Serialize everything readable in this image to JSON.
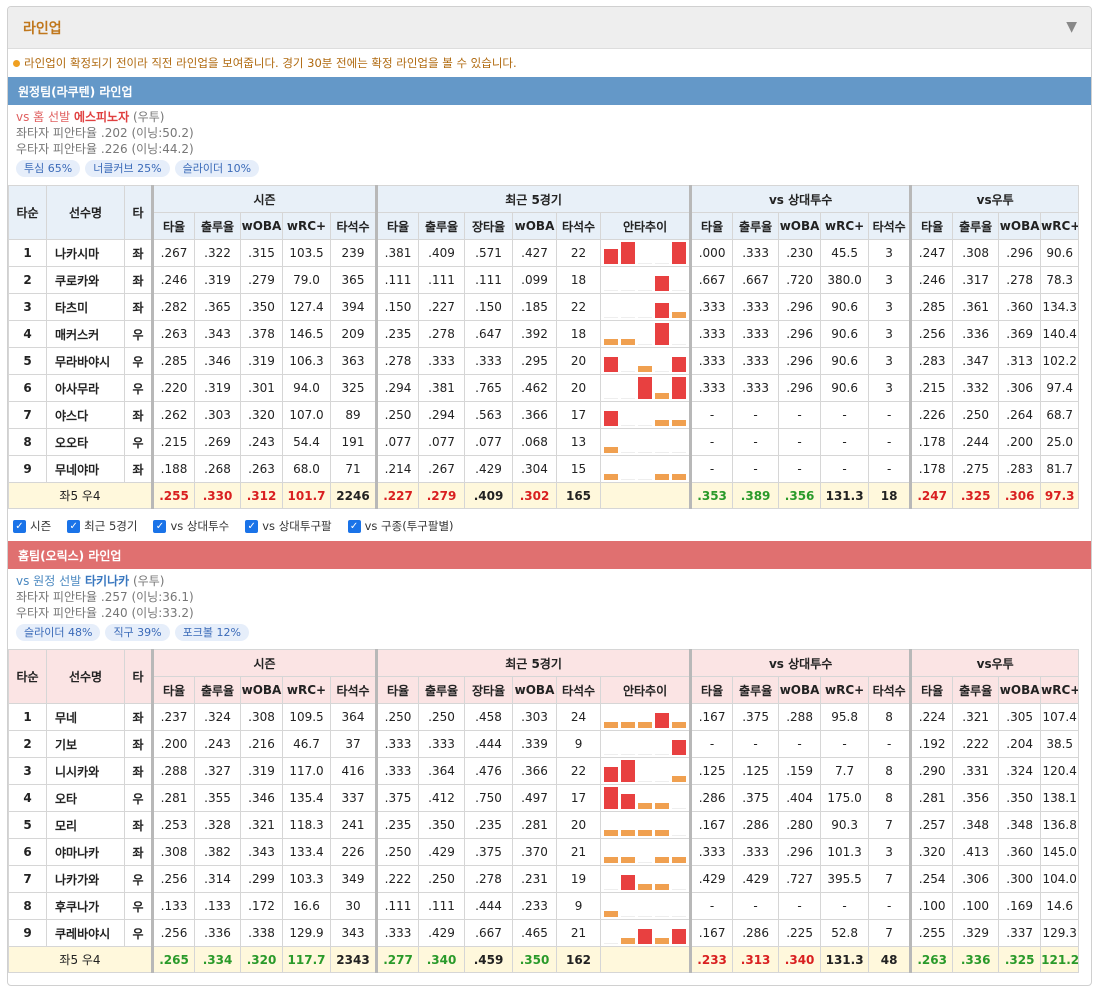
{
  "header": {
    "title": "라인업",
    "toggle_icon": "triangle-down-icon"
  },
  "notice": "라인업이 확정되기 전이라 직전 라인업을 보여줍니다. 경기 30분 전에는 확정 라인업을 볼 수 있습니다.",
  "columns": {
    "order": "타순",
    "name": "선수명",
    "hand": "타",
    "groups": [
      "시즌",
      "최근 5경기",
      "vs 상대투수",
      "vs우투"
    ],
    "season": [
      "타율",
      "출루율",
      "wOBA",
      "wRC+",
      "타석수"
    ],
    "recent": [
      "타율",
      "출루율",
      "장타율",
      "wOBA",
      "타석수",
      "안타추이"
    ],
    "vs_pitcher": [
      "타율",
      "출루율",
      "wOBA",
      "wRC+",
      "타석수"
    ],
    "vs_hand": [
      "타율",
      "출루율",
      "wOBA",
      "wRC+"
    ]
  },
  "checkboxes": [
    "시즌",
    "최근 5경기",
    "vs 상대투수",
    "vs 상대투구팔",
    "vs 구종(투구팔별)"
  ],
  "away": {
    "team_label": "원정팀(라쿠텐) 라인업",
    "vs_prefix": "vs 홈 선발",
    "pitcher": "에스피노자",
    "pitcher_hand": "(우투)",
    "vs_left": "좌타자 피안타율 .202 (이닝:50.2)",
    "vs_right": "우타자 피안타율 .226 (이닝:44.2)",
    "pitches": [
      "투심 65%",
      "너클커브 25%",
      "슬라이더 10%"
    ],
    "rows": [
      {
        "o": "1",
        "n": "나카시마",
        "h": "좌",
        "s": [
          ".267",
          ".322",
          ".315",
          "103.5",
          "239"
        ],
        "r": [
          ".381",
          ".409",
          ".571",
          ".427",
          "22"
        ],
        "c": [
          1,
          2,
          0,
          0,
          2
        ],
        "p": [
          ".000",
          ".333",
          ".230",
          "45.5",
          "3"
        ],
        "v": [
          ".247",
          ".308",
          ".296",
          "90.6"
        ]
      },
      {
        "o": "2",
        "n": "쿠로카와",
        "h": "좌",
        "s": [
          ".246",
          ".319",
          ".279",
          "79.0",
          "365"
        ],
        "r": [
          ".111",
          ".111",
          ".111",
          ".099",
          "18"
        ],
        "c": [
          0,
          0,
          0,
          1,
          0
        ],
        "p": [
          ".667",
          ".667",
          ".720",
          "380.0",
          "3"
        ],
        "v": [
          ".246",
          ".317",
          ".278",
          "78.3"
        ]
      },
      {
        "o": "3",
        "n": "타츠미",
        "h": "좌",
        "s": [
          ".282",
          ".365",
          ".350",
          "127.4",
          "394"
        ],
        "r": [
          ".150",
          ".227",
          ".150",
          ".185",
          "22"
        ],
        "c": [
          0,
          0,
          0,
          1,
          0.5
        ],
        "p": [
          ".333",
          ".333",
          ".296",
          "90.6",
          "3"
        ],
        "v": [
          ".285",
          ".361",
          ".360",
          "134.3"
        ]
      },
      {
        "o": "4",
        "n": "매커스커",
        "h": "우",
        "s": [
          ".263",
          ".343",
          ".378",
          "146.5",
          "209"
        ],
        "r": [
          ".235",
          ".278",
          ".647",
          ".392",
          "18"
        ],
        "c": [
          0.5,
          0.5,
          0,
          2,
          0
        ],
        "p": [
          ".333",
          ".333",
          ".296",
          "90.6",
          "3"
        ],
        "v": [
          ".256",
          ".336",
          ".369",
          "140.4"
        ]
      },
      {
        "o": "5",
        "n": "무라바야시",
        "h": "우",
        "s": [
          ".285",
          ".346",
          ".319",
          "106.3",
          "363"
        ],
        "r": [
          ".278",
          ".333",
          ".333",
          ".295",
          "20"
        ],
        "c": [
          1,
          0,
          0.5,
          0,
          1
        ],
        "p": [
          ".333",
          ".333",
          ".296",
          "90.6",
          "3"
        ],
        "v": [
          ".283",
          ".347",
          ".313",
          "102.2"
        ]
      },
      {
        "o": "6",
        "n": "아사무라",
        "h": "우",
        "s": [
          ".220",
          ".319",
          ".301",
          "94.0",
          "325"
        ],
        "r": [
          ".294",
          ".381",
          ".765",
          ".462",
          "20"
        ],
        "c": [
          0,
          0,
          2,
          0.5,
          2
        ],
        "p": [
          ".333",
          ".333",
          ".296",
          "90.6",
          "3"
        ],
        "v": [
          ".215",
          ".332",
          ".306",
          "97.4"
        ]
      },
      {
        "o": "7",
        "n": "야스다",
        "h": "좌",
        "s": [
          ".262",
          ".303",
          ".320",
          "107.0",
          "89"
        ],
        "r": [
          ".250",
          ".294",
          ".563",
          ".366",
          "17"
        ],
        "c": [
          1,
          0,
          0,
          0.5,
          0.5
        ],
        "p": [
          "-",
          "-",
          "-",
          "-",
          "-"
        ],
        "v": [
          ".226",
          ".250",
          ".264",
          "68.7"
        ]
      },
      {
        "o": "8",
        "n": "오오타",
        "h": "우",
        "s": [
          ".215",
          ".269",
          ".243",
          "54.4",
          "191"
        ],
        "r": [
          ".077",
          ".077",
          ".077",
          ".068",
          "13"
        ],
        "c": [
          0.5,
          0,
          0,
          0,
          0
        ],
        "p": [
          "-",
          "-",
          "-",
          "-",
          "-"
        ],
        "v": [
          ".178",
          ".244",
          ".200",
          "25.0"
        ]
      },
      {
        "o": "9",
        "n": "무네야마",
        "h": "좌",
        "s": [
          ".188",
          ".268",
          ".263",
          "68.0",
          "71"
        ],
        "r": [
          ".214",
          ".267",
          ".429",
          ".304",
          "15"
        ],
        "c": [
          0.5,
          0,
          0,
          0.5,
          0.5
        ],
        "p": [
          "-",
          "-",
          "-",
          "-",
          "-"
        ],
        "v": [
          ".178",
          ".275",
          ".283",
          "81.7"
        ]
      }
    ],
    "total": {
      "label": "좌5 우4",
      "s": [
        ".255",
        ".330",
        ".312",
        "101.7",
        "2246"
      ],
      "sc": [
        "red",
        "red",
        "red",
        "red",
        "blk"
      ],
      "r": [
        ".227",
        ".279",
        ".409",
        ".302",
        "165"
      ],
      "rc": [
        "red",
        "red",
        "blk",
        "red",
        "blk"
      ],
      "p": [
        ".353",
        ".389",
        ".356",
        "131.3",
        "18"
      ],
      "pc": [
        "green",
        "green",
        "green",
        "blk",
        "blk"
      ],
      "v": [
        ".247",
        ".325",
        ".306",
        "97.3"
      ],
      "vc": [
        "red",
        "red",
        "red",
        "red"
      ]
    }
  },
  "home": {
    "team_label": "홈팀(오릭스) 라인업",
    "vs_prefix": "vs 원정 선발",
    "pitcher": "타키나카",
    "pitcher_hand": "(우투)",
    "vs_left": "좌타자 피안타율 .257 (이닝:36.1)",
    "vs_right": "우타자 피안타율 .240 (이닝:33.2)",
    "pitches": [
      "슬라이더 48%",
      "직구 39%",
      "포크볼 12%"
    ],
    "rows": [
      {
        "o": "1",
        "n": "무네",
        "h": "좌",
        "s": [
          ".237",
          ".324",
          ".308",
          "109.5",
          "364"
        ],
        "r": [
          ".250",
          ".250",
          ".458",
          ".303",
          "24"
        ],
        "c": [
          0.5,
          0.5,
          0.5,
          1,
          0.5
        ],
        "p": [
          ".167",
          ".375",
          ".288",
          "95.8",
          "8"
        ],
        "v": [
          ".224",
          ".321",
          ".305",
          "107.4"
        ]
      },
      {
        "o": "2",
        "n": "기보",
        "h": "좌",
        "s": [
          ".200",
          ".243",
          ".216",
          "46.7",
          "37"
        ],
        "r": [
          ".333",
          ".333",
          ".444",
          ".339",
          "9"
        ],
        "c": [
          0,
          0,
          0,
          0,
          1
        ],
        "p": [
          "-",
          "-",
          "-",
          "-",
          "-"
        ],
        "v": [
          ".192",
          ".222",
          ".204",
          "38.5"
        ]
      },
      {
        "o": "3",
        "n": "니시카와",
        "h": "좌",
        "s": [
          ".288",
          ".327",
          ".319",
          "117.0",
          "416"
        ],
        "r": [
          ".333",
          ".364",
          ".476",
          ".366",
          "22"
        ],
        "c": [
          1,
          2,
          0,
          0,
          0.5
        ],
        "p": [
          ".125",
          ".125",
          ".159",
          "7.7",
          "8"
        ],
        "v": [
          ".290",
          ".331",
          ".324",
          "120.4"
        ]
      },
      {
        "o": "4",
        "n": "오타",
        "h": "우",
        "s": [
          ".281",
          ".355",
          ".346",
          "135.4",
          "337"
        ],
        "r": [
          ".375",
          ".412",
          ".750",
          ".497",
          "17"
        ],
        "c": [
          2,
          1,
          0.5,
          0.5,
          0
        ],
        "p": [
          ".286",
          ".375",
          ".404",
          "175.0",
          "8"
        ],
        "v": [
          ".281",
          ".356",
          ".350",
          "138.1"
        ]
      },
      {
        "o": "5",
        "n": "모리",
        "h": "좌",
        "s": [
          ".253",
          ".328",
          ".321",
          "118.3",
          "241"
        ],
        "r": [
          ".235",
          ".350",
          ".235",
          ".281",
          "20"
        ],
        "c": [
          0.5,
          0.5,
          0.5,
          0.5,
          0
        ],
        "p": [
          ".167",
          ".286",
          ".280",
          "90.3",
          "7"
        ],
        "v": [
          ".257",
          ".348",
          ".348",
          "136.8"
        ]
      },
      {
        "o": "6",
        "n": "야마나카",
        "h": "좌",
        "s": [
          ".308",
          ".382",
          ".343",
          "133.4",
          "226"
        ],
        "r": [
          ".250",
          ".429",
          ".375",
          ".370",
          "21"
        ],
        "c": [
          0.5,
          0.5,
          0,
          0.5,
          0.5
        ],
        "p": [
          ".333",
          ".333",
          ".296",
          "101.3",
          "3"
        ],
        "v": [
          ".320",
          ".413",
          ".360",
          "145.0"
        ]
      },
      {
        "o": "7",
        "n": "나카가와",
        "h": "우",
        "s": [
          ".256",
          ".314",
          ".299",
          "103.3",
          "349"
        ],
        "r": [
          ".222",
          ".250",
          ".278",
          ".231",
          "19"
        ],
        "c": [
          0,
          1,
          0.5,
          0.5,
          0
        ],
        "p": [
          ".429",
          ".429",
          ".727",
          "395.5",
          "7"
        ],
        "v": [
          ".254",
          ".306",
          ".300",
          "104.0"
        ]
      },
      {
        "o": "8",
        "n": "후쿠나가",
        "h": "우",
        "s": [
          ".133",
          ".133",
          ".172",
          "16.6",
          "30"
        ],
        "r": [
          ".111",
          ".111",
          ".444",
          ".233",
          "9"
        ],
        "c": [
          0.5,
          0,
          0,
          0,
          0
        ],
        "p": [
          "-",
          "-",
          "-",
          "-",
          "-"
        ],
        "v": [
          ".100",
          ".100",
          ".169",
          "14.6"
        ]
      },
      {
        "o": "9",
        "n": "쿠레바야시",
        "h": "우",
        "s": [
          ".256",
          ".336",
          ".338",
          "129.9",
          "343"
        ],
        "r": [
          ".333",
          ".429",
          ".667",
          ".465",
          "21"
        ],
        "c": [
          0,
          0.5,
          1,
          0.5,
          1
        ],
        "p": [
          ".167",
          ".286",
          ".225",
          "52.8",
          "7"
        ],
        "v": [
          ".255",
          ".329",
          ".337",
          "129.3"
        ]
      }
    ],
    "total": {
      "label": "좌5 우4",
      "s": [
        ".265",
        ".334",
        ".320",
        "117.7",
        "2343"
      ],
      "sc": [
        "green",
        "green",
        "green",
        "green",
        "blk"
      ],
      "r": [
        ".277",
        ".340",
        ".459",
        ".350",
        "162"
      ],
      "rc": [
        "green",
        "green",
        "blk",
        "green",
        "blk"
      ],
      "p": [
        ".233",
        ".313",
        ".340",
        "131.3",
        "48"
      ],
      "pc": [
        "red",
        "red",
        "red",
        "blk",
        "blk"
      ],
      "v": [
        ".263",
        ".336",
        ".325",
        "121.2"
      ],
      "vc": [
        "green",
        "green",
        "green",
        "green"
      ]
    }
  }
}
